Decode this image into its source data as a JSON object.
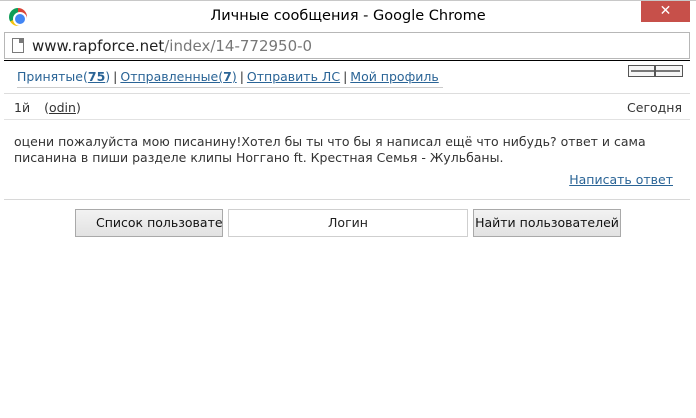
{
  "window": {
    "title": "Личные сообщения - Google Chrome",
    "close_glyph": "✕"
  },
  "address": {
    "domain": "www.rapforce.net",
    "path": "/index/14-772950-0"
  },
  "nav": {
    "inbox_label": "Принятые(",
    "inbox_count": "75",
    "inbox_close": ")",
    "outbox_label": "Отправленные(",
    "outbox_count": "7",
    "outbox_close": ")",
    "send_label": "Отправить ЛС",
    "profile_label": "Мой профиль",
    "separator": "|"
  },
  "message": {
    "number": "1й",
    "sender_open": "(",
    "sender": "odin",
    "sender_close": ")",
    "date": "Сегодня",
    "text": "оцени пожалуйста мою писанину!Хотел бы ты что бы я написал ещё что нибудь? ответ и сама писанина в пиши разделе клипы Ноггано ft. Крестная Семья - Жульбаны.",
    "reply_label": "Написать ответ"
  },
  "actions": {
    "users_list_label": "Список пользователей",
    "login_value": "Логин",
    "find_users_label": "Найти пользователей"
  }
}
